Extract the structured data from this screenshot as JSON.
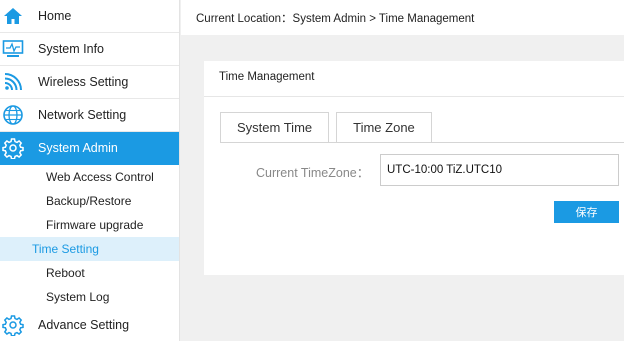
{
  "sidebar": {
    "items": [
      {
        "label": "Home",
        "icon": "home-icon"
      },
      {
        "label": "System Info",
        "icon": "monitor-icon"
      },
      {
        "label": "Wireless Setting",
        "icon": "wifi-icon"
      },
      {
        "label": "Network Setting",
        "icon": "globe-icon"
      },
      {
        "label": "System Admin",
        "icon": "gear-icon"
      },
      {
        "label": "Advance Setting",
        "icon": "gear-icon"
      }
    ],
    "sub_items": [
      {
        "label": "Web Access Control"
      },
      {
        "label": "Backup/Restore"
      },
      {
        "label": "Firmware upgrade"
      },
      {
        "label": "Time Setting"
      },
      {
        "label": "Reboot"
      },
      {
        "label": "System Log"
      }
    ]
  },
  "breadcrumb": "Current Location：System Admin > Time Management",
  "panel": {
    "title": "Time Management",
    "tabs": [
      {
        "label": "System Time"
      },
      {
        "label": "Time Zone"
      }
    ],
    "timezone_label": "Current TimeZone：",
    "timezone_value": "UTC-10:00 TiZ.UTC10",
    "save_label": "保存"
  },
  "colors": {
    "accent": "#1b9ae3",
    "active_sub_bg": "#ddf0fb"
  }
}
